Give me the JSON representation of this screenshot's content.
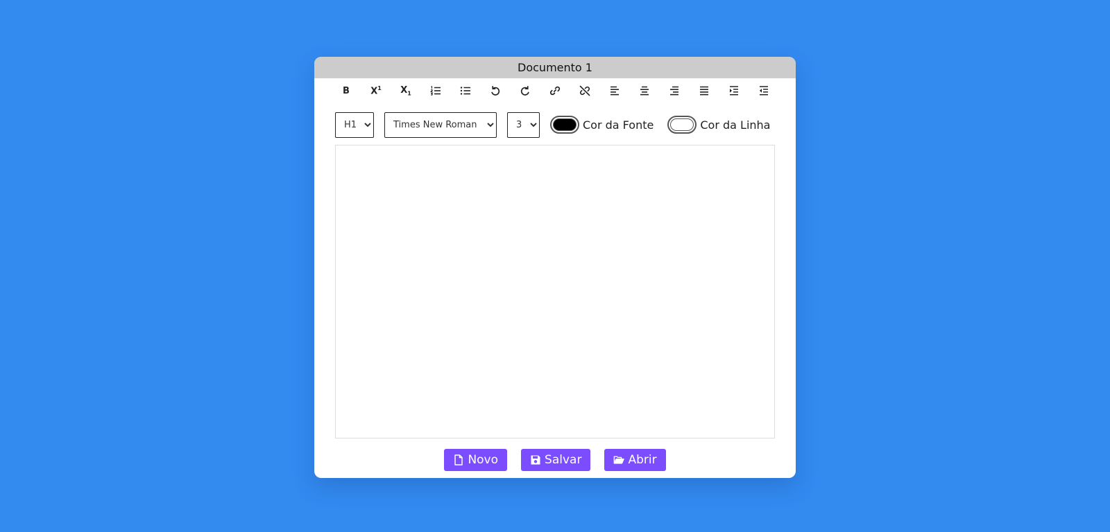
{
  "document": {
    "title": "Documento 1"
  },
  "toolbar": {
    "bold_label": "B",
    "superscript_label": "X",
    "superscript_mark": "1",
    "subscript_label": "X",
    "subscript_mark": "1",
    "icons": [
      "bold-icon",
      "superscript-icon",
      "subscript-icon",
      "ordered-list-icon",
      "unordered-list-icon",
      "undo-icon",
      "redo-icon",
      "link-icon",
      "unlink-icon",
      "align-left-icon",
      "align-center-icon",
      "align-right-icon",
      "justify-icon",
      "indent-icon",
      "outdent-icon"
    ]
  },
  "format": {
    "heading": "H1",
    "font_name": "Times New Roman",
    "font_size": "3",
    "font_color_label": "Cor da Fonte",
    "font_color_value": "#000000",
    "line_color_label": "Cor da Linha",
    "line_color_value": "#ffffff"
  },
  "buttons": {
    "new_label": "Novo",
    "save_label": "Salvar",
    "open_label": "Abrir"
  },
  "colors": {
    "background": "#338aef",
    "title_bar": "#cccccc",
    "button": "#7c4dff"
  }
}
